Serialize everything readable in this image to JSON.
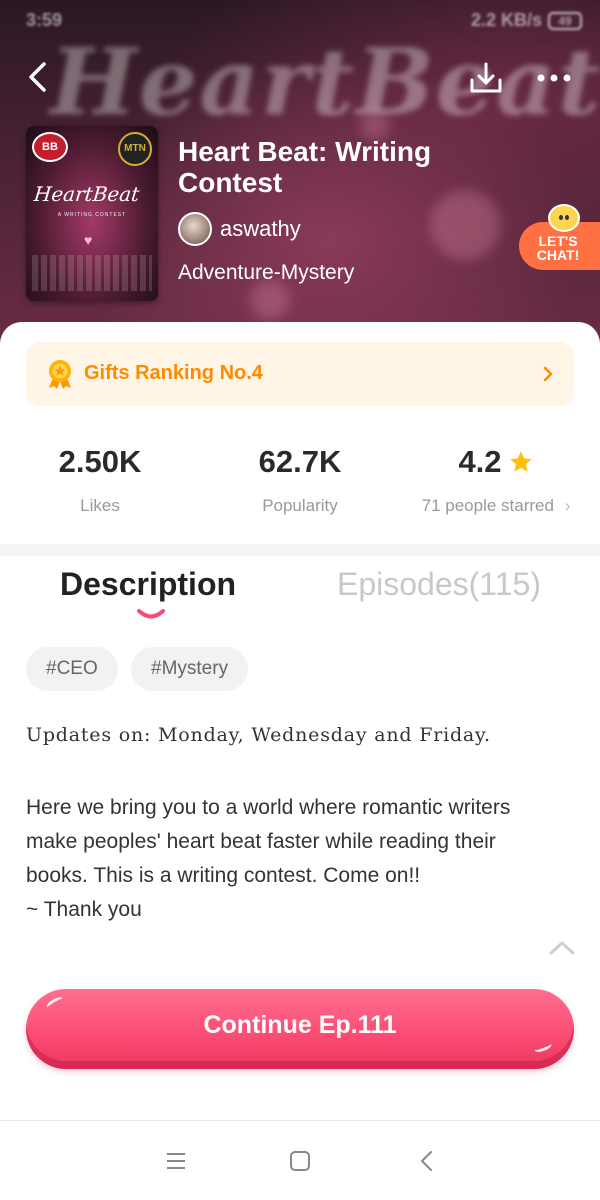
{
  "status_bar": {
    "time": "3:59",
    "speed": "2.2 KB/s",
    "battery": "49"
  },
  "hero": {
    "watermark": "HeartBeat",
    "title": "Heart Beat: Writing Contest",
    "author": "aswathy",
    "genre": "Adventure-Mystery",
    "chat_badge": "LET'S CHAT!",
    "cover": {
      "title": "HeartBeat",
      "subtitle": "A WRITING CONTEST",
      "badge_left": "BB",
      "badge_right": "MTN"
    }
  },
  "ranking": {
    "label": "Gifts Ranking No.4"
  },
  "stats": [
    {
      "value": "2.50K",
      "label": "Likes"
    },
    {
      "value": "62.7K",
      "label": "Popularity"
    },
    {
      "value": "4.2",
      "label": "71 people starred",
      "has_star": true
    }
  ],
  "tabs": [
    {
      "label": "Description",
      "active": true
    },
    {
      "label": "Episodes(115)",
      "active": false
    }
  ],
  "tags": [
    "#CEO",
    "#Mystery"
  ],
  "description": {
    "updates": "Updates on: Monday, Wednesday and Friday.",
    "body": "Here we bring you to a world where romantic writers make peoples' heart beat faster while reading their books. This is a writing contest. Come on!!\n~ Thank you"
  },
  "cta": {
    "label": "Continue Ep.111"
  },
  "colors": {
    "accent_pink": "#fa4b72",
    "ranking_orange": "#ff8a00",
    "ranking_bg": "#fff5e6",
    "chat_orange": "#ff7043",
    "star_yellow": "#ffc107"
  },
  "icons": {
    "back": "chevron-left-icon",
    "download": "download-icon",
    "more": "more-dots-icon",
    "medal": "medal-icon",
    "ranking_chevron": "chevron-right-icon",
    "star": "star-icon",
    "collapse": "chevron-up-icon",
    "nav": [
      "menu-icon",
      "home-square-icon",
      "back-triangle-icon"
    ]
  }
}
